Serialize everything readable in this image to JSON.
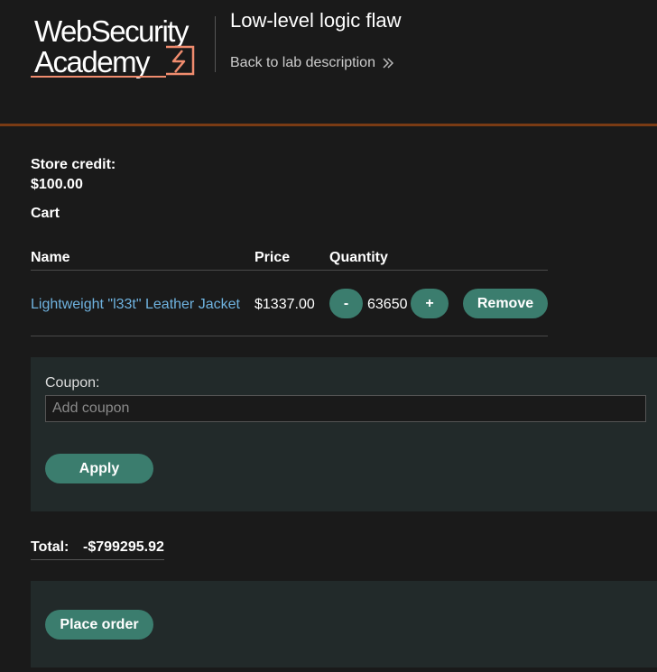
{
  "header": {
    "logo_line1": "WebSecurity",
    "logo_line2": "Academy",
    "lab_title": "Low-level logic flaw",
    "back_link": "Back to lab description"
  },
  "account": {
    "credit_label": "Store credit:",
    "credit_value": "$100.00"
  },
  "cart": {
    "heading": "Cart",
    "columns": [
      "Name",
      "Price",
      "Quantity"
    ],
    "items": [
      {
        "name": "Lightweight \"l33t\" Leather Jacket",
        "price": "$1337.00",
        "quantity": "63650",
        "decrement_label": "-",
        "increment_label": "+",
        "remove_label": "Remove"
      }
    ]
  },
  "coupon": {
    "label": "Coupon:",
    "placeholder": "Add coupon",
    "value": "",
    "apply_label": "Apply"
  },
  "total": {
    "label": "Total:",
    "value": "-$799295.92"
  },
  "order": {
    "place_label": "Place order"
  },
  "colors": {
    "background": "#1a1a1a",
    "accent_button": "#3b7d6e",
    "link": "#6fb3e0",
    "header_rule": "#7a3b14",
    "panel": "#222a2a",
    "logo_mark": "#f08c6e"
  },
  "icons": {
    "back": "double-chevron-right-icon",
    "logo_mark": "lightning-bolt-icon"
  }
}
